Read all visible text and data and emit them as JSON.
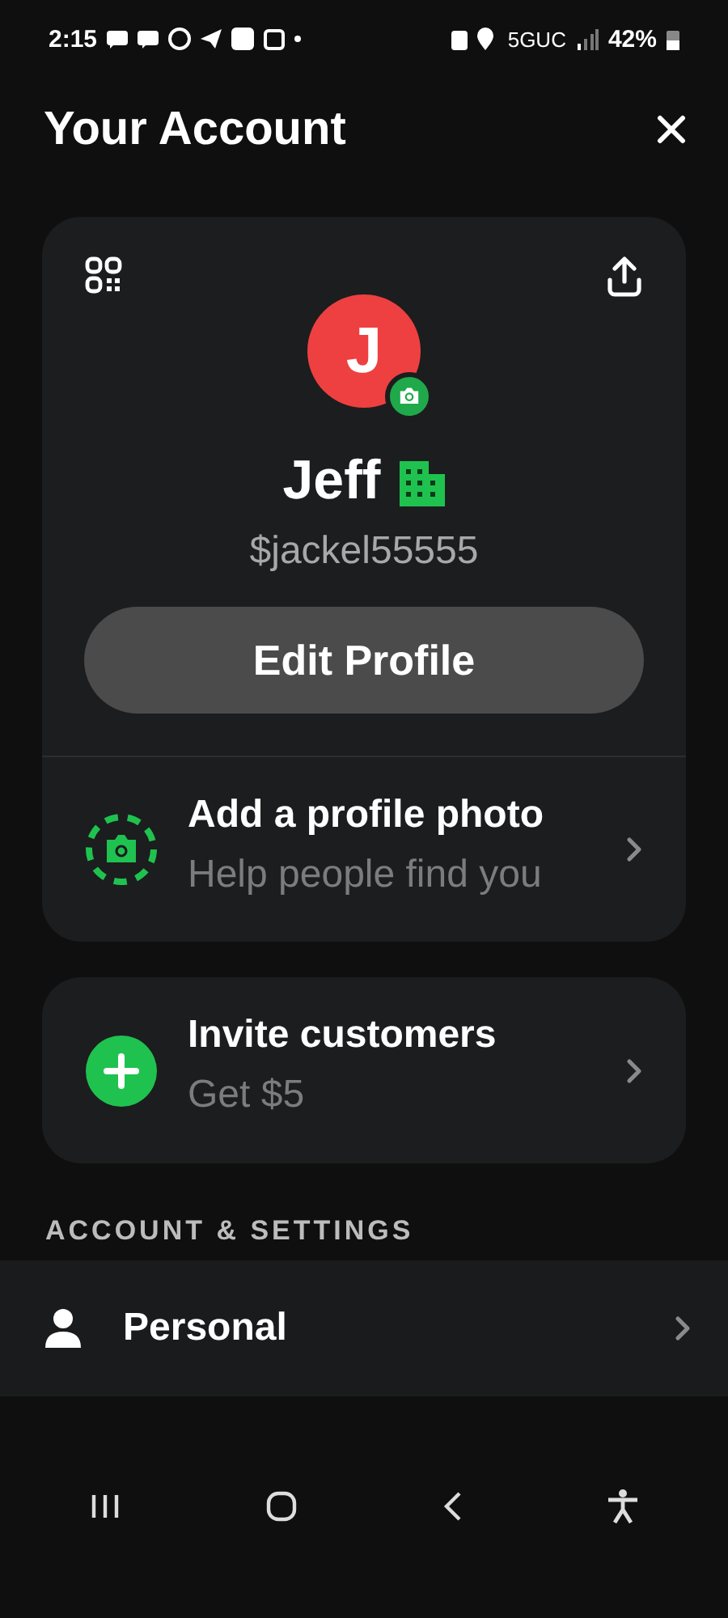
{
  "status_bar": {
    "time": "2:15",
    "network": "5GUC",
    "battery": "42%"
  },
  "header": {
    "title": "Your Account"
  },
  "profile": {
    "initial": "J",
    "name": "Jeff",
    "handle": "$jackel55555",
    "edit_button": "Edit Profile"
  },
  "prompts": [
    {
      "kind": "photo",
      "title": "Add a profile photo",
      "subtitle": "Help people find you"
    }
  ],
  "invite": {
    "kind": "invite",
    "title": "Invite customers",
    "subtitle": "Get $5"
  },
  "section": {
    "title": "ACCOUNT & SETTINGS"
  },
  "settings": [
    {
      "label": "Personal"
    }
  ]
}
